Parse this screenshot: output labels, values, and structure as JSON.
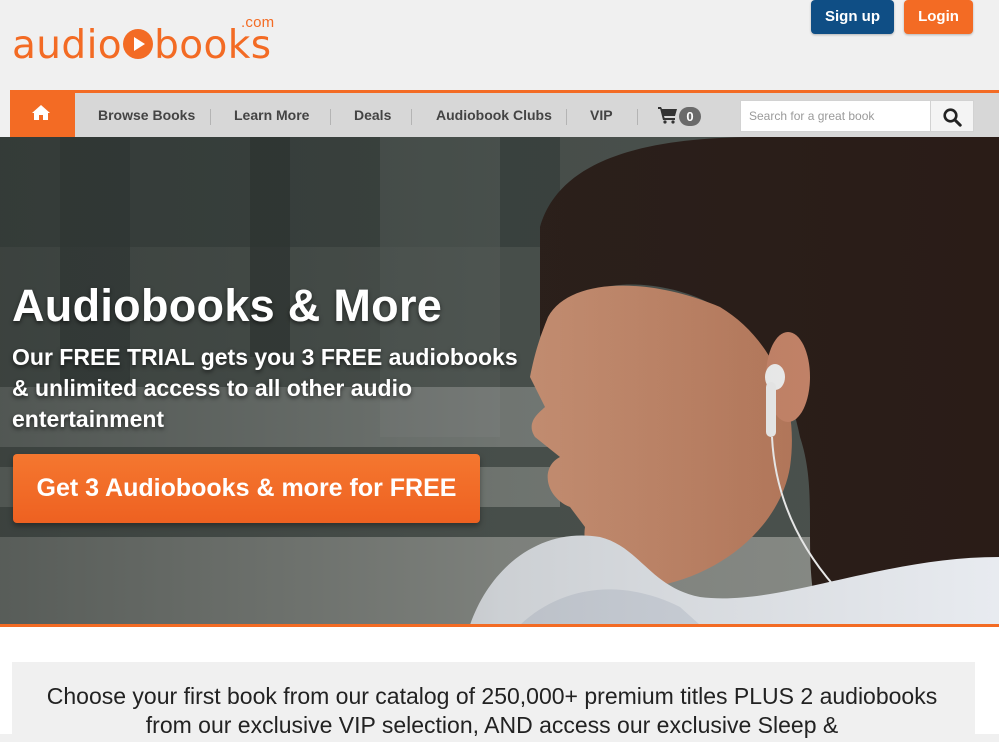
{
  "header": {
    "logo_word": "audiobooks",
    "logo_word_a": "audio",
    "logo_word_b": "books",
    "logo_tld": ".com",
    "signup_label": "Sign up",
    "login_label": "Login"
  },
  "nav": {
    "items": [
      {
        "label": "Browse Books"
      },
      {
        "label": "Learn More"
      },
      {
        "label": "Deals"
      },
      {
        "label": "Audiobook Clubs"
      },
      {
        "label": "VIP"
      }
    ],
    "cart_count": "0",
    "search": {
      "placeholder": "Search for a great book",
      "value": ""
    }
  },
  "hero": {
    "title": "Audiobooks & More",
    "subtitle": "Our FREE TRIAL gets you 3 FREE audiobooks & unlimited access to all other audio entertainment",
    "cta_label": "Get 3 Audiobooks & more for FREE"
  },
  "content": {
    "intro": "Choose your first book from our catalog of 250,000+ premium titles PLUS 2 audiobooks from our exclusive VIP selection, AND access our exclusive Sleep &"
  },
  "colors": {
    "brand_orange": "#f36b24",
    "signup_blue": "#0f4e85",
    "nav_gray": "#d7d7d7"
  }
}
